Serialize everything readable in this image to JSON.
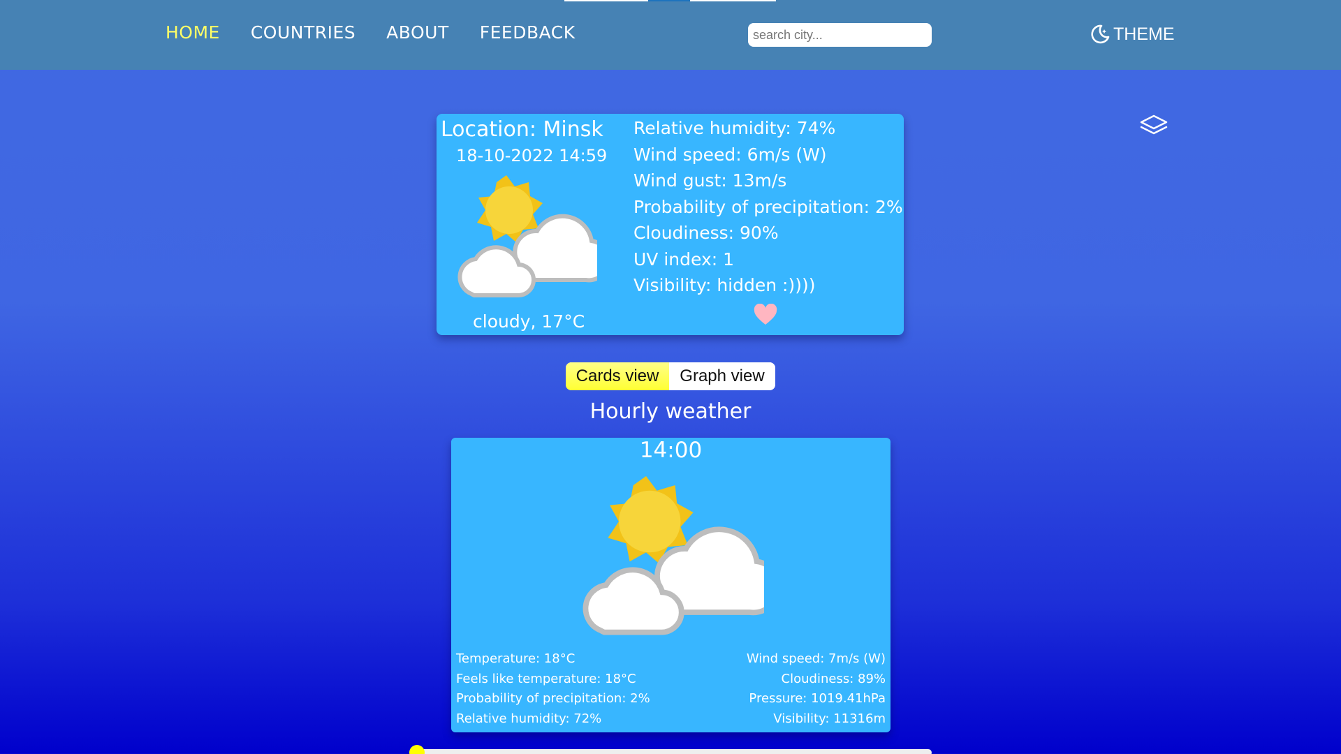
{
  "nav": {
    "items": [
      {
        "label": "HOME",
        "active": true
      },
      {
        "label": "COUNTRIES",
        "active": false
      },
      {
        "label": "ABOUT",
        "active": false
      },
      {
        "label": "FEEDBACK",
        "active": false
      }
    ]
  },
  "search": {
    "placeholder": "search city...",
    "value": ""
  },
  "theme": {
    "label": "THEME",
    "icon": "moon-icon"
  },
  "current": {
    "location": "Location: Minsk",
    "datetime": "18-10-2022 14:59",
    "icon": "partly-cloudy-icon",
    "description": "cloudy, 17°C",
    "details": [
      "Relative humidity: 74%",
      "Wind speed: 6m/s (W)",
      "Wind gust: 13m/s",
      "Probability of precipitation: 2%",
      "Cloudiness: 90%",
      "UV index: 1",
      "Visibility: hidden :))))"
    ],
    "favorite_icon": "heart-icon"
  },
  "view_toggle": {
    "cards_label": "Cards view",
    "graph_label": "Graph view",
    "selected": "Cards view"
  },
  "hourly": {
    "title": "Hourly weather",
    "card": {
      "time": "14:00",
      "icon": "partly-cloudy-icon",
      "left": [
        "Temperature: 18°C",
        "Feels like temperature: 18°C",
        "Probability of precipitation: 2%",
        "Relative humidity: 72%"
      ],
      "right": [
        "Wind speed: 7m/s (W)",
        "Cloudiness: 89%",
        "Pressure: 1019.41hPa",
        "Visibility: 11316m"
      ]
    }
  },
  "slider": {
    "value": 0
  },
  "colors": {
    "header": "#4682b4",
    "card": "#38b6ff",
    "active_nav": "#ffff66",
    "toggle_selected": "#ffff33",
    "heart": "#ffb6c1",
    "slider_thumb": "#ffff00"
  }
}
